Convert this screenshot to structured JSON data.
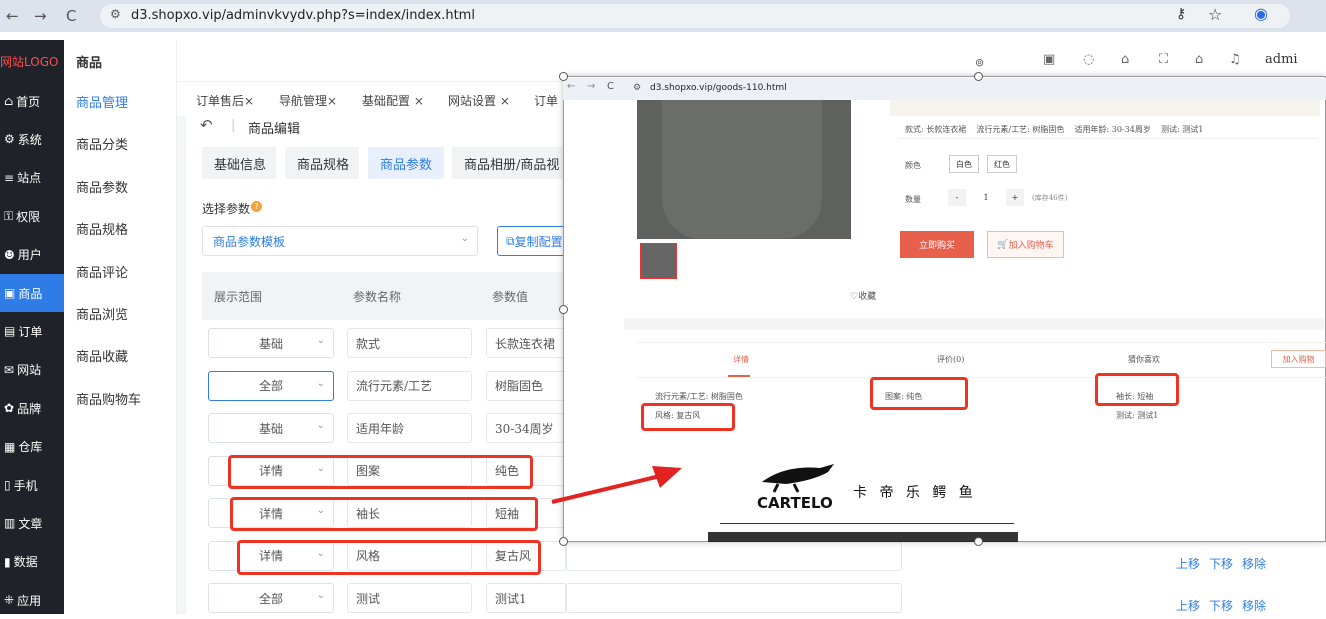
{
  "browser": {
    "url": "d3.shopxo.vip/adminvkvydv.php?s=index/index.html"
  },
  "sidebar": {
    "logo": "网站LOGO",
    "items": [
      {
        "label": "首页",
        "icon": "home-icon"
      },
      {
        "label": "系统",
        "icon": "gear-icon"
      },
      {
        "label": "站点",
        "icon": "sliders-icon"
      },
      {
        "label": "权限",
        "icon": "user-lock-icon"
      },
      {
        "label": "用户",
        "icon": "users-icon"
      },
      {
        "label": "商品",
        "icon": "goods-icon"
      },
      {
        "label": "订单",
        "icon": "order-icon"
      },
      {
        "label": "网站",
        "icon": "chat-icon"
      },
      {
        "label": "品牌",
        "icon": "brand-icon"
      },
      {
        "label": "仓库",
        "icon": "warehouse-icon"
      },
      {
        "label": "手机",
        "icon": "phone-icon"
      },
      {
        "label": "文章",
        "icon": "article-icon"
      },
      {
        "label": "数据",
        "icon": "chart-icon"
      },
      {
        "label": "应用",
        "icon": "apps-icon"
      }
    ]
  },
  "submenu": {
    "title": "商品",
    "items": [
      "商品管理",
      "商品分类",
      "商品参数",
      "商品规格",
      "商品评论",
      "商品浏览",
      "商品收藏",
      "商品购物车"
    ]
  },
  "topbar": {
    "user": "admi"
  },
  "tabs": [
    "订单售后×",
    "导航管理×",
    "基础配置 ×",
    "网站设置 ×",
    "订单"
  ],
  "page": {
    "back_title": "商品编辑",
    "segments": [
      "基础信息",
      "商品规格",
      "商品参数",
      "商品相册/商品视"
    ],
    "select_label": "选择参数",
    "template_placeholder": "商品参数模板",
    "copy_button": "复制配置",
    "table_headers": [
      "展示范围",
      "参数名称",
      "参数值"
    ],
    "rows": [
      {
        "scope": "基础",
        "name": "款式",
        "value": "长款连衣裙"
      },
      {
        "scope": "全部",
        "name": "流行元素/工艺",
        "value": "树脂固色"
      },
      {
        "scope": "基础",
        "name": "适用年龄",
        "value": "30-34周岁"
      },
      {
        "scope": "详情",
        "name": "图案",
        "value": "纯色"
      },
      {
        "scope": "详情",
        "name": "袖长",
        "value": "短袖"
      },
      {
        "scope": "详情",
        "name": "风格",
        "value": "复古风"
      },
      {
        "scope": "全部",
        "name": "测试",
        "value": "测试1"
      }
    ],
    "row_actions": [
      "上移",
      "下移",
      "移除"
    ]
  },
  "popup": {
    "url": "d3.shopxo.vip/goods-110.html",
    "attrs_line": "款式: 长款连衣裙    流行元素/工艺: 树脂固色    适用年龄: 30-34周岁    测试: 测试1",
    "color_label": "颜色",
    "colors": [
      "白色",
      "红色"
    ],
    "qty_label": "数量",
    "qty": "1",
    "stock": "(库存46件)",
    "buy_now": "立即购买",
    "add_cart": "加入购物车",
    "favorite": "收藏",
    "detail_tabs": [
      "详情",
      "评价(0)",
      "猜你喜欢"
    ],
    "add_cart_small": "加入购物",
    "detail_params": [
      "流行元素/工艺: 树脂固色",
      "风格: 复古风",
      "图案: 纯色",
      "袖长: 短袖",
      "测试: 测试1"
    ],
    "brand_en": "CARTELO",
    "brand_cn": "卡 帝 乐 鳄 鱼"
  },
  "colors": {
    "accent": "#2e7de6",
    "sidebar": "#1f2228",
    "highlight": "#e32222",
    "buy": "#e8604c"
  }
}
